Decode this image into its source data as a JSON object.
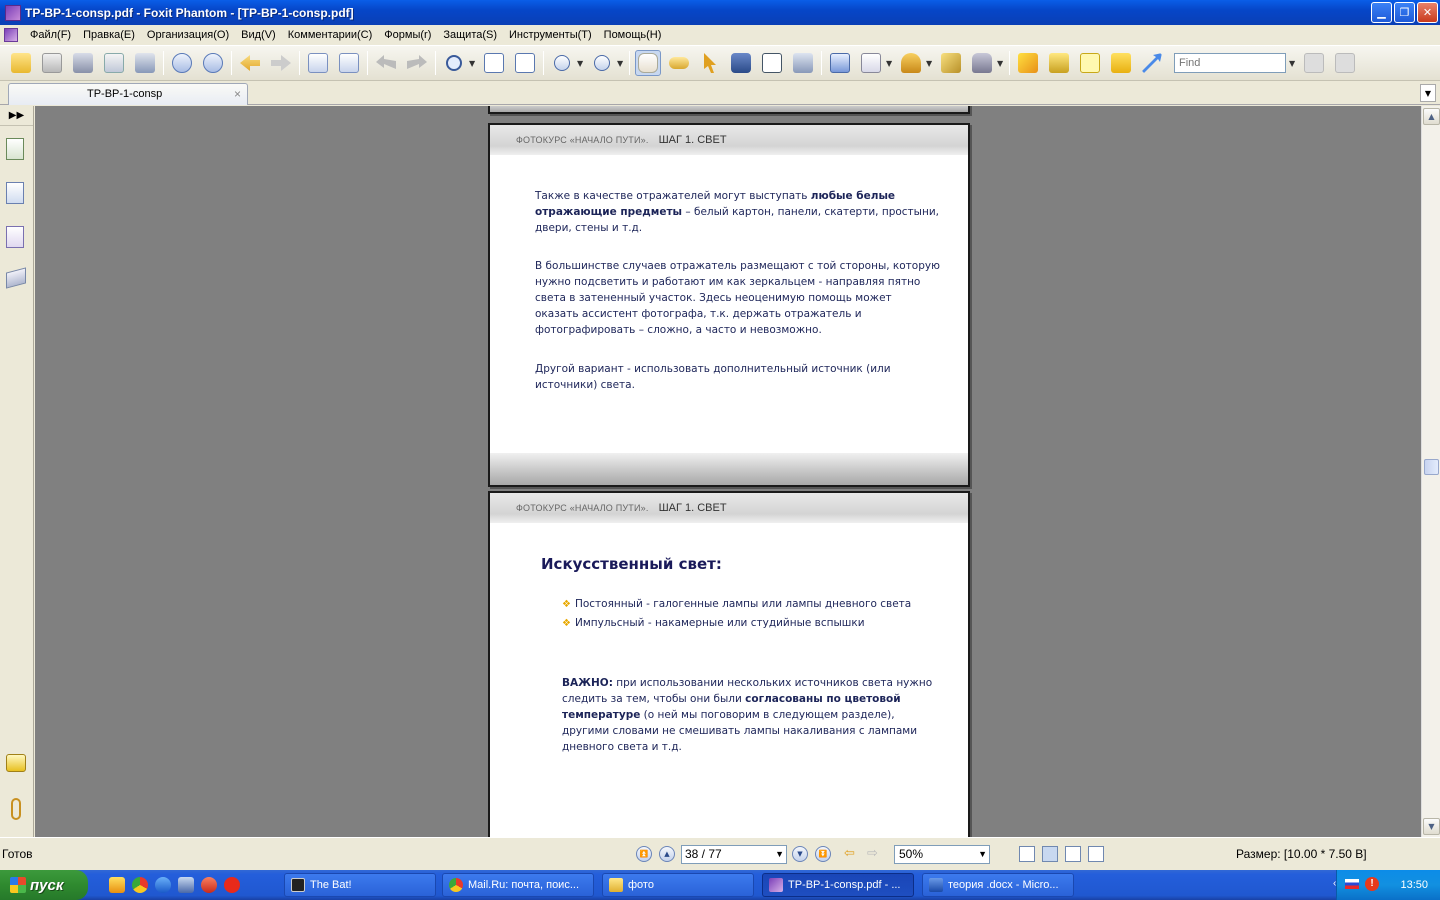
{
  "window": {
    "title": "TP-BP-1-consp.pdf - Foxit Phantom - [TP-BP-1-consp.pdf]",
    "min_icon": "minimize-icon",
    "max_icon": "restore-icon",
    "close_icon": "close-icon"
  },
  "menu": [
    "Файл(F)",
    "Правка(E)",
    "Организация(O)",
    "Вид(V)",
    "Комментарии(C)",
    "Формы(r)",
    "Защита(S)",
    "Инструменты(T)",
    "Помощь(H)"
  ],
  "toolbar": {
    "find_placeholder": "Find"
  },
  "tab": {
    "label": "TP-BP-1-consp",
    "close": "×"
  },
  "pages": {
    "header_course": "ФОТОКУРС «НАЧАЛО ПУТИ».",
    "header_step": "ШАГ 1.  СВЕТ",
    "p1": {
      "para1_a": "Также в качестве отражателей могут выступать ",
      "para1_b": "любые белые",
      "para1_c": "отражающие предметы",
      "para1_d": " – белый картон, панели, скатерти, простыни,",
      "para1_e": "двери, стены и т.д.",
      "para2_l1": "В большинстве случаев отражатель размещают с той стороны, которую",
      "para2_l2": "нужно подсветить и работают им как зеркальцем - направляя пятно",
      "para2_l3": "света в затененный участок. Здесь неоценимую помощь может",
      "para2_l4": "оказать ассистент фотографа, т.к. держать отражатель и",
      "para2_l5": "фотографировать – сложно, а часто и невозможно.",
      "para3_l1": "Другой вариант - использовать дополнительный источник (или",
      "para3_l2": "источники) света."
    },
    "p2": {
      "title": "Искусственный свет:",
      "bullets": [
        "Постоянный - галогенные лампы или лампы дневного света",
        "Импульсный - накамерные или студийные вспышки"
      ],
      "imp_label": "ВАЖНО:",
      "imp_l1": "  при использовании нескольких источников света нужно",
      "imp_l2a": "следить за тем, чтобы они были ",
      "imp_l2b": "согласованы по цветовой",
      "imp_l3a": "температуре",
      "imp_l3b": " (о ней мы поговорим в следующем разделе),",
      "imp_l4": "другими словами не смешивать лампы накаливания с лампами",
      "imp_l5": "дневного света и т.д."
    }
  },
  "status": {
    "ready": "Готов",
    "page_value": "38 / 77",
    "zoom_value": "50%",
    "size": "Размер: [10.00 * 7.50 В]"
  },
  "taskbar": {
    "start": "пуск",
    "tasks": [
      "The Bat!",
      "Mail.Ru: почта, поис...",
      "фото",
      "TP-BP-1-consp.pdf - ...",
      "теория .docx - Micro..."
    ],
    "clock": "13:50"
  },
  "colors": {
    "accent": "#0a5ee8",
    "pdf_text": "#1c2458",
    "bullet": "#e8a800",
    "start_green": "#2f8a2f"
  }
}
